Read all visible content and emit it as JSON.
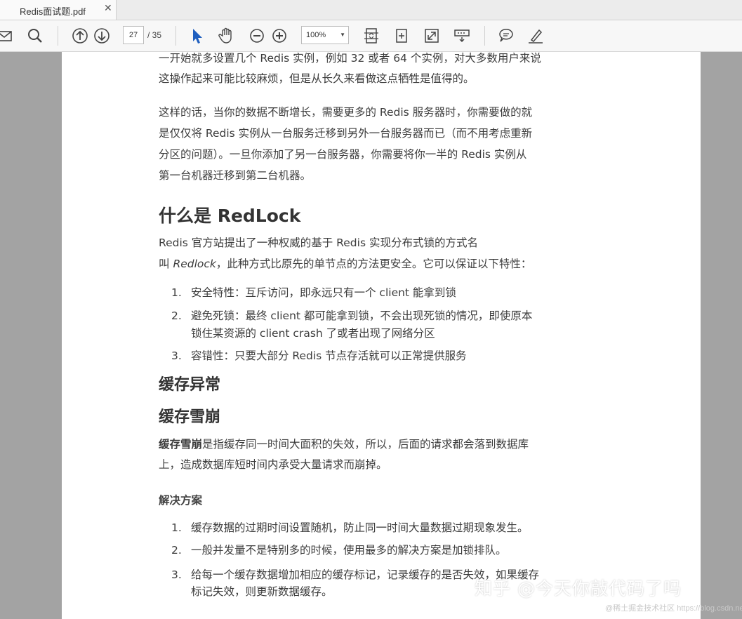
{
  "tab": {
    "title": "Redis面试题.pdf",
    "close": "✕"
  },
  "toolbar": {
    "page_current": "27",
    "page_total": "/ 35",
    "zoom": "100%",
    "icons": [
      "mail-icon",
      "search-icon",
      "page-up-icon",
      "page-down-icon",
      "select-pointer-icon",
      "hand-icon",
      "zoom-out-icon",
      "zoom-in-icon",
      "fit-page-icon",
      "rotate-icon",
      "fullscreen-icon",
      "scroll-mode-icon",
      "comment-icon",
      "sign-icon"
    ]
  },
  "doc": {
    "p1_l1": "一开始就多设置几个 Redis 实例，例如 32 或者 64 个实例，对大多数用户来说",
    "p1_l2": "这操作起来可能比较麻烦，但是从长久来看做这点牺牲是值得的。",
    "p2_l1": "这样的话，当你的数据不断增长，需要更多的 Redis 服务器时，你需要做的就",
    "p2_l2": "是仅仅将 Redis 实例从一台服务迁移到另外一台服务器而已（而不用考虑重新",
    "p2_l3": "分区的问题）。一旦你添加了另一台服务器，你需要将你一半的 Redis 实例从",
    "p2_l4": "第一台机器迁移到第二台机器。",
    "h_redlock": "什么是  RedLock",
    "p3_l1": "Redis  官方站提出了一种权威的基于  Redis  实现分布式锁的方式名",
    "p3_l2_a": "叫 ",
    "p3_l2_b": "Redlock",
    "p3_l2_c": "，此种方式比原先的单节点的方法更安全。它可以保证以下特性：",
    "list1": [
      {
        "num": "1.",
        "l1": "安全特性：互斥访问，即永远只有一个  client  能拿到锁",
        "l2": ""
      },
      {
        "num": "2.",
        "l1": "避免死锁：最终  client  都可能拿到锁，不会出现死锁的情况，即使原本",
        "l2": "锁住某资源的  client crash  了或者出现了网络分区"
      },
      {
        "num": "3.",
        "l1": "容错性：只要大部分  Redis  节点存活就可以正常提供服务",
        "l2": ""
      }
    ],
    "h_cache_ex": "缓存异常",
    "h_avalanche": "缓存雪崩",
    "p4_l1_b": "缓存雪崩",
    "p4_l1_rest": "是指缓存同一时间大面积的失效，所以，后面的请求都会落到数据库",
    "p4_l2": "上，造成数据库短时间内承受大量请求而崩掉。",
    "h_solution": "解决方案",
    "list2": [
      {
        "num": "1.",
        "l1": "缓存数据的过期时间设置随机，防止同一时间大量数据过期现象发生。",
        "l2": ""
      },
      {
        "num": "2.",
        "l1": "一般并发量不是特别多的时候，使用最多的解决方案是加锁排队。",
        "l2": ""
      },
      {
        "num": "3.",
        "l1": "给每一个缓存数据增加相应的缓存标记，记录缓存的是否失效，如果缓存",
        "l2": "标记失效，则更新数据缓存。"
      }
    ]
  },
  "watermark": {
    "zhihu": "知乎 @今天你敲代码了吗",
    "csdn": "@稀土掘金技术社区 https://blog.csdn.net/libaiup"
  }
}
